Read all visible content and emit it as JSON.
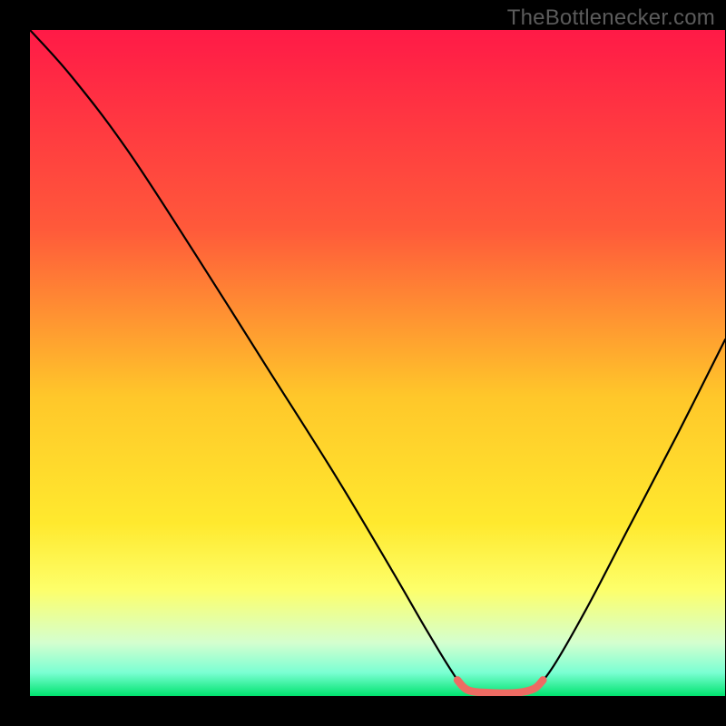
{
  "watermark": "TheBottlenecker.com",
  "chart_data": {
    "type": "line",
    "title": "",
    "xlabel": "",
    "ylabel": "",
    "xlim": [
      0,
      100
    ],
    "ylim": [
      0,
      100
    ],
    "gradient_stops": [
      {
        "offset": 0,
        "color": "#ff1a47"
      },
      {
        "offset": 0.3,
        "color": "#ff5a3a"
      },
      {
        "offset": 0.55,
        "color": "#ffc72a"
      },
      {
        "offset": 0.74,
        "color": "#ffe92e"
      },
      {
        "offset": 0.84,
        "color": "#fdff6a"
      },
      {
        "offset": 0.92,
        "color": "#d4ffcf"
      },
      {
        "offset": 0.965,
        "color": "#7affd3"
      },
      {
        "offset": 1.0,
        "color": "#00e36e"
      }
    ],
    "series": [
      {
        "name": "bottleneck-curve",
        "color": "#000000",
        "width": 2.2,
        "points": [
          {
            "x": 0.0,
            "y": 100.0
          },
          {
            "x": 6.0,
            "y": 93.0
          },
          {
            "x": 14.0,
            "y": 82.0
          },
          {
            "x": 24.0,
            "y": 66.0
          },
          {
            "x": 34.0,
            "y": 49.5
          },
          {
            "x": 44.0,
            "y": 33.0
          },
          {
            "x": 52.0,
            "y": 19.0
          },
          {
            "x": 57.0,
            "y": 10.0
          },
          {
            "x": 60.5,
            "y": 4.0
          },
          {
            "x": 62.5,
            "y": 1.3
          },
          {
            "x": 65.0,
            "y": 0.45
          },
          {
            "x": 70.0,
            "y": 0.45
          },
          {
            "x": 72.5,
            "y": 1.3
          },
          {
            "x": 75.0,
            "y": 4.0
          },
          {
            "x": 80.0,
            "y": 13.0
          },
          {
            "x": 86.0,
            "y": 25.0
          },
          {
            "x": 93.0,
            "y": 39.0
          },
          {
            "x": 100.0,
            "y": 53.5
          }
        ]
      },
      {
        "name": "optimal-band-marker",
        "color": "#ee6b63",
        "width": 8.5,
        "points": [
          {
            "x": 61.5,
            "y": 2.4
          },
          {
            "x": 63.0,
            "y": 0.9
          },
          {
            "x": 66.0,
            "y": 0.5
          },
          {
            "x": 70.0,
            "y": 0.5
          },
          {
            "x": 72.5,
            "y": 1.1
          },
          {
            "x": 73.8,
            "y": 2.4
          }
        ]
      }
    ]
  }
}
